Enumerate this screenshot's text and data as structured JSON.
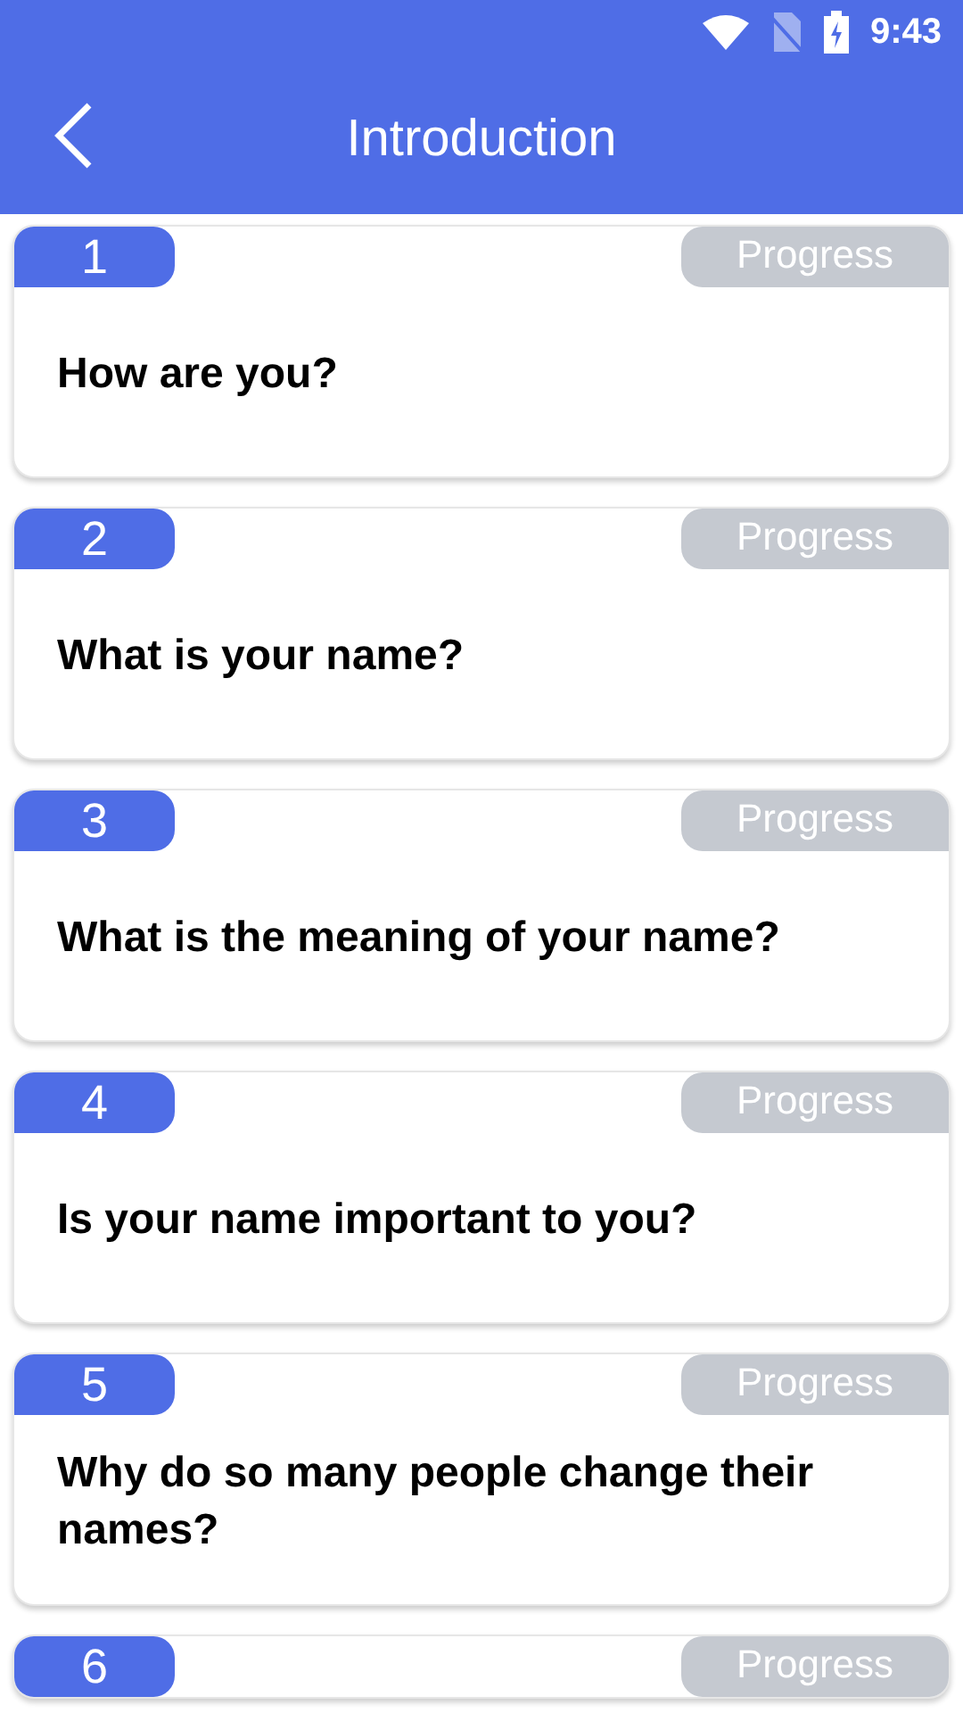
{
  "status_bar": {
    "time": "9:43"
  },
  "header": {
    "title": "Introduction"
  },
  "questions": [
    {
      "number": "1",
      "progress": "Progress",
      "question": "How are you?"
    },
    {
      "number": "2",
      "progress": "Progress",
      "question": "What is your name?"
    },
    {
      "number": "3",
      "progress": "Progress",
      "question": "What is the meaning of your name?"
    },
    {
      "number": "4",
      "progress": "Progress",
      "question": "Is your name important to you?"
    },
    {
      "number": "5",
      "progress": "Progress",
      "question": "Why do so many people change their names?"
    },
    {
      "number": "6",
      "progress": "Progress"
    }
  ]
}
